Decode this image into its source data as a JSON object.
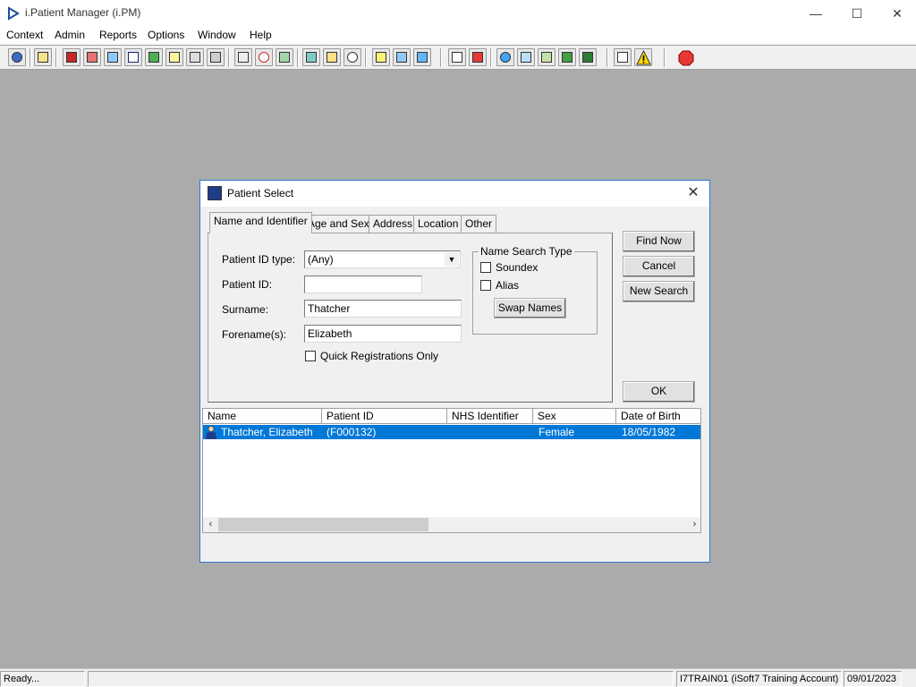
{
  "window": {
    "title": "i.Patient Manager (i.PM)",
    "minimize": "—",
    "maximize": "☐",
    "close": "✕"
  },
  "menu": [
    "Context",
    "Admin",
    "Reports",
    "Options",
    "Window",
    "Help"
  ],
  "status": {
    "message": "Ready...",
    "empty": "",
    "account": "I7TRAIN01 (iSoft7 Training Account)",
    "date": "09/01/2023"
  },
  "dialog": {
    "title": "Patient Select",
    "close": "✕",
    "tabs": [
      "Name and Identifier",
      "Age and Sex",
      "Address",
      "Location",
      "Other"
    ],
    "labels": {
      "id_type": "Patient ID type:",
      "patient_id": "Patient ID:",
      "surname": "Surname:",
      "forename": "Forename(s):",
      "quick_reg": "Quick Registrations Only"
    },
    "fields": {
      "id_type": "(Any)",
      "patient_id": "",
      "surname": "Thatcher",
      "forename": "Elizabeth"
    },
    "name_search": {
      "title": "Name Search Type",
      "soundex": "Soundex",
      "alias": "Alias",
      "swap_names": "Swap Names"
    },
    "buttons": {
      "find_now": "Find Now",
      "cancel": "Cancel",
      "new_search": "New Search",
      "ok": "OK"
    },
    "results": {
      "columns": [
        "Name",
        "Patient ID",
        "NHS Identifier",
        "Sex",
        "Date of Birth"
      ],
      "rows": [
        {
          "name": "Thatcher, Elizabeth",
          "patient_id": "(F000132)",
          "nhs_id": "",
          "sex": "Female",
          "dob": "18/05/1982"
        }
      ],
      "scroll_left": "‹",
      "scroll_right": "›"
    }
  },
  "colors": {
    "desktop": "#ababab",
    "selection": "#0078d7",
    "dialog_border": "#2b79d1"
  }
}
